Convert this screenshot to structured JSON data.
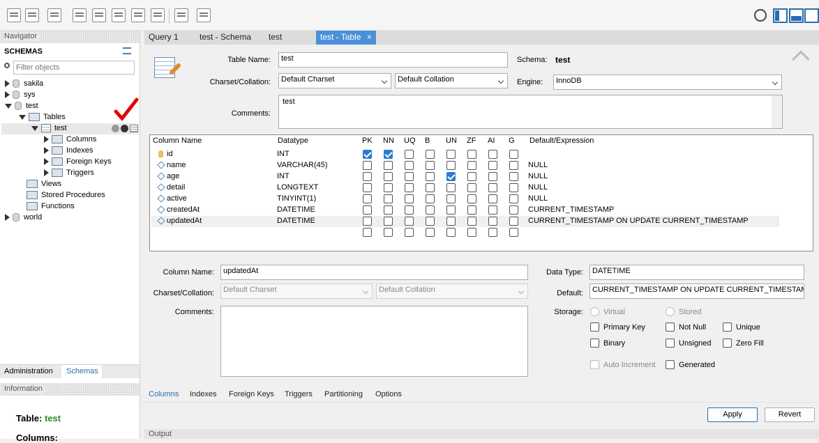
{
  "navigator": {
    "title": "Navigator",
    "schemas_heading": "SCHEMAS",
    "filter_placeholder": "Filter objects",
    "tree": {
      "sakila": "sakila",
      "sys": "sys",
      "test": "test",
      "tables": "Tables",
      "table_test": "test",
      "columns": "Columns",
      "indexes": "Indexes",
      "foreign_keys": "Foreign Keys",
      "triggers": "Triggers",
      "views": "Views",
      "stored_procedures": "Stored Procedures",
      "functions": "Functions",
      "world": "world"
    },
    "bottom_tabs": [
      "Administration",
      "Schemas"
    ],
    "information_title": "Information",
    "info_table_label": "Table:",
    "info_table_value": "test",
    "info_columns_label": "Columns:"
  },
  "tabs": [
    "Query 1",
    "test - Schema",
    "test",
    "test - Table"
  ],
  "active_tab": "test - Table",
  "close_glyph": "×",
  "editor": {
    "table_name_label": "Table Name:",
    "table_name": "test",
    "schema_label": "Schema:",
    "schema": "test",
    "charset_label": "Charset/Collation:",
    "charset": "Default Charset",
    "collation": "Default Collation",
    "engine_label": "Engine:",
    "engine": "InnoDB",
    "comments_label": "Comments:",
    "comments": "test"
  },
  "grid": {
    "headers": [
      "Column Name",
      "Datatype",
      "PK",
      "NN",
      "UQ",
      "B",
      "UN",
      "ZF",
      "AI",
      "G",
      "Default/Expression"
    ],
    "rows": [
      {
        "name": "id",
        "type": "INT",
        "flags": [
          true,
          true,
          false,
          false,
          false,
          false,
          false,
          false
        ],
        "default": ""
      },
      {
        "name": "name",
        "type": "VARCHAR(45)",
        "flags": [
          false,
          false,
          false,
          false,
          false,
          false,
          false,
          false
        ],
        "default": "NULL"
      },
      {
        "name": "age",
        "type": "INT",
        "flags": [
          false,
          false,
          false,
          false,
          true,
          false,
          false,
          false
        ],
        "default": "NULL"
      },
      {
        "name": "detail",
        "type": "LONGTEXT",
        "flags": [
          false,
          false,
          false,
          false,
          false,
          false,
          false,
          false
        ],
        "default": "NULL"
      },
      {
        "name": "active",
        "type": "TINYINT(1)",
        "flags": [
          false,
          false,
          false,
          false,
          false,
          false,
          false,
          false
        ],
        "default": "NULL"
      },
      {
        "name": "createdAt",
        "type": "DATETIME",
        "flags": [
          false,
          false,
          false,
          false,
          false,
          false,
          false,
          false
        ],
        "default": "CURRENT_TIMESTAMP"
      },
      {
        "name": "updatedAt",
        "type": "DATETIME",
        "flags": [
          false,
          false,
          false,
          false,
          false,
          false,
          false,
          false
        ],
        "default": "CURRENT_TIMESTAMP ON UPDATE CURRENT_TIMESTAMP"
      }
    ]
  },
  "details": {
    "column_name_label": "Column Name:",
    "column_name": "updatedAt",
    "charset_label": "Charset/Collation:",
    "charset": "Default Charset",
    "collation": "Default Collation",
    "comments_label": "Comments:",
    "data_type_label": "Data Type:",
    "data_type": "DATETIME",
    "default_label": "Default:",
    "default": "CURRENT_TIMESTAMP ON UPDATE CURRENT_TIMESTAMP",
    "storage_label": "Storage:",
    "virtual": "Virtual",
    "stored": "Stored",
    "primary_key": "Primary Key",
    "not_null": "Not Null",
    "unique": "Unique",
    "binary": "Binary",
    "unsigned": "Unsigned",
    "zero_fill": "Zero Fill",
    "auto_increment": "Auto Increment",
    "generated": "Generated"
  },
  "bottom_tabs": [
    "Columns",
    "Indexes",
    "Foreign Keys",
    "Triggers",
    "Partitioning",
    "Options"
  ],
  "buttons": {
    "apply": "Apply",
    "revert": "Revert"
  },
  "output_label": "Output"
}
